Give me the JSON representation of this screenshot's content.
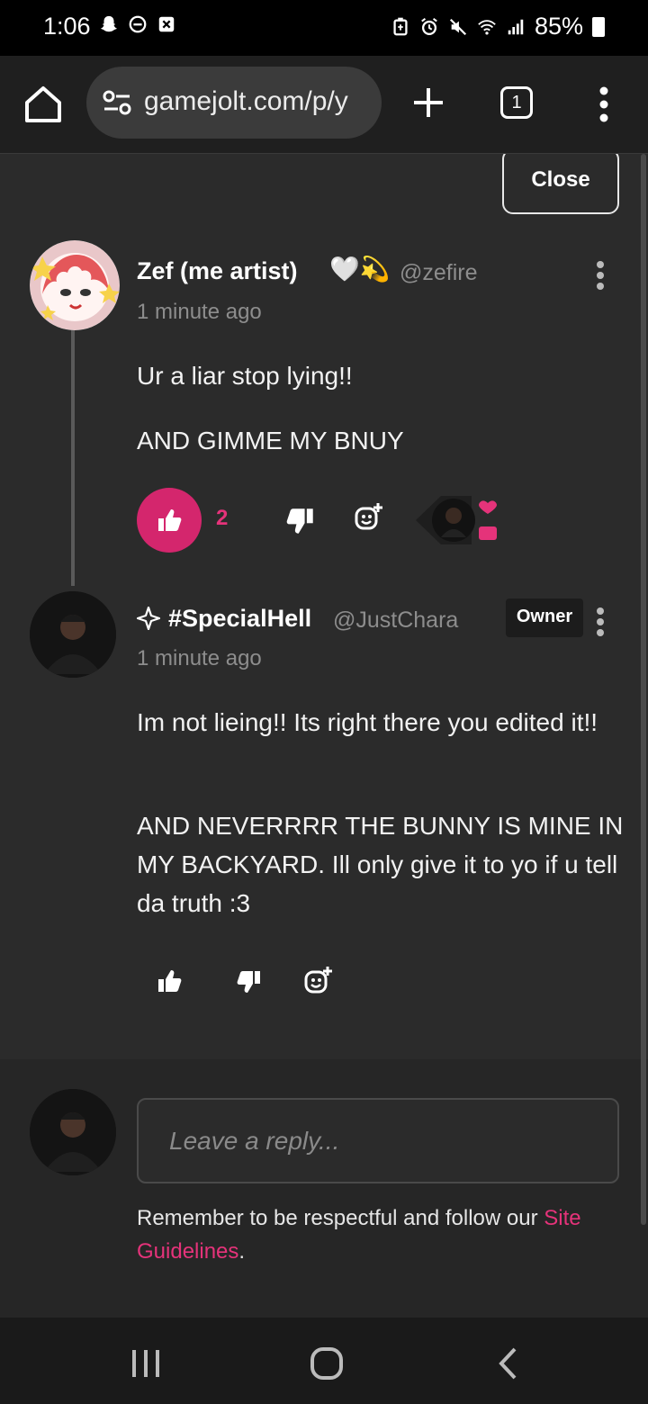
{
  "status": {
    "time": "1:06",
    "battery": "85%"
  },
  "browser": {
    "url": "gamejolt.com/p/y",
    "tab_count": "1"
  },
  "dialog": {
    "close_label": "Close"
  },
  "comments": [
    {
      "name": "Zef (me artist)",
      "name_emoji": "🤍💫",
      "handle": "@zefire",
      "time": "1 minute ago",
      "paragraphs": [
        "Ur a liar stop lying!!",
        "AND GIMME MY BNUY"
      ],
      "like_count": "2"
    },
    {
      "name": "#SpecialHell",
      "handle": "@JustChara",
      "badge": "Owner",
      "time": "1 minute ago",
      "paragraphs": [
        "Im not lieing!! Its right there you edited it!!",
        "AND NEVERRRR THE BUNNY IS MINE IN MY BACKYARD. Ill only give it to yo if u tell da truth :3"
      ]
    }
  ],
  "reply": {
    "placeholder": "Leave a reply...",
    "notice": "Remember to be respectful and follow our ",
    "link_label": "Site Guidelines",
    "notice_end": "."
  },
  "colors": {
    "accent": "#d4266d",
    "background": "#2b2b2b"
  }
}
